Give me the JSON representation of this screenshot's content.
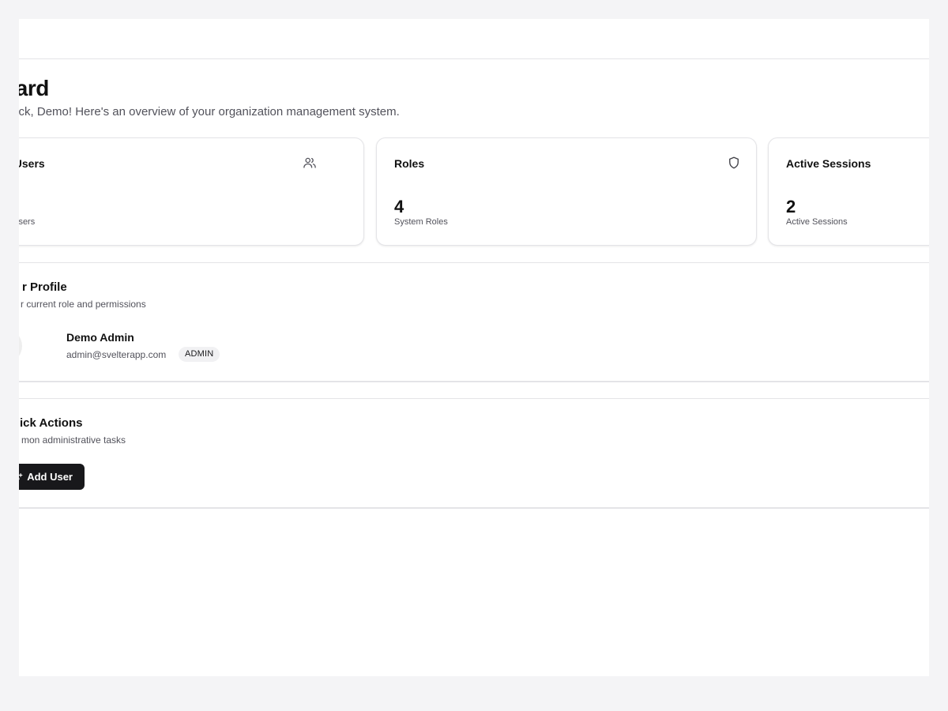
{
  "header": {
    "title": "hboard",
    "subtitle": "ne back, Demo! Here's an overview of your organization management system."
  },
  "stats": [
    {
      "title": "l Users",
      "value": "",
      "caption": "l Users",
      "icon": "users-icon"
    },
    {
      "title": "Roles",
      "value": "4",
      "caption": "System Roles",
      "icon": "shield-icon"
    },
    {
      "title": "Active Sessions",
      "value": "2",
      "caption": "Active Sessions",
      "icon": ""
    }
  ],
  "profile": {
    "title": "r Profile",
    "description": "r current role and permissions",
    "name": "Demo Admin",
    "email": "admin@svelterapp.com",
    "role": "ADMIN",
    "avatar_icon": "user-icon"
  },
  "quick_actions": {
    "title": "ick Actions",
    "description": "mon administrative tasks",
    "add_user_label": "Add User",
    "add_user_icon": "user-plus-icon"
  },
  "colors": {
    "background": "#f4f4f6",
    "surface": "#ffffff",
    "border": "#e4e4e7",
    "muted_text": "#52525b",
    "primary_button": "#18181b"
  }
}
